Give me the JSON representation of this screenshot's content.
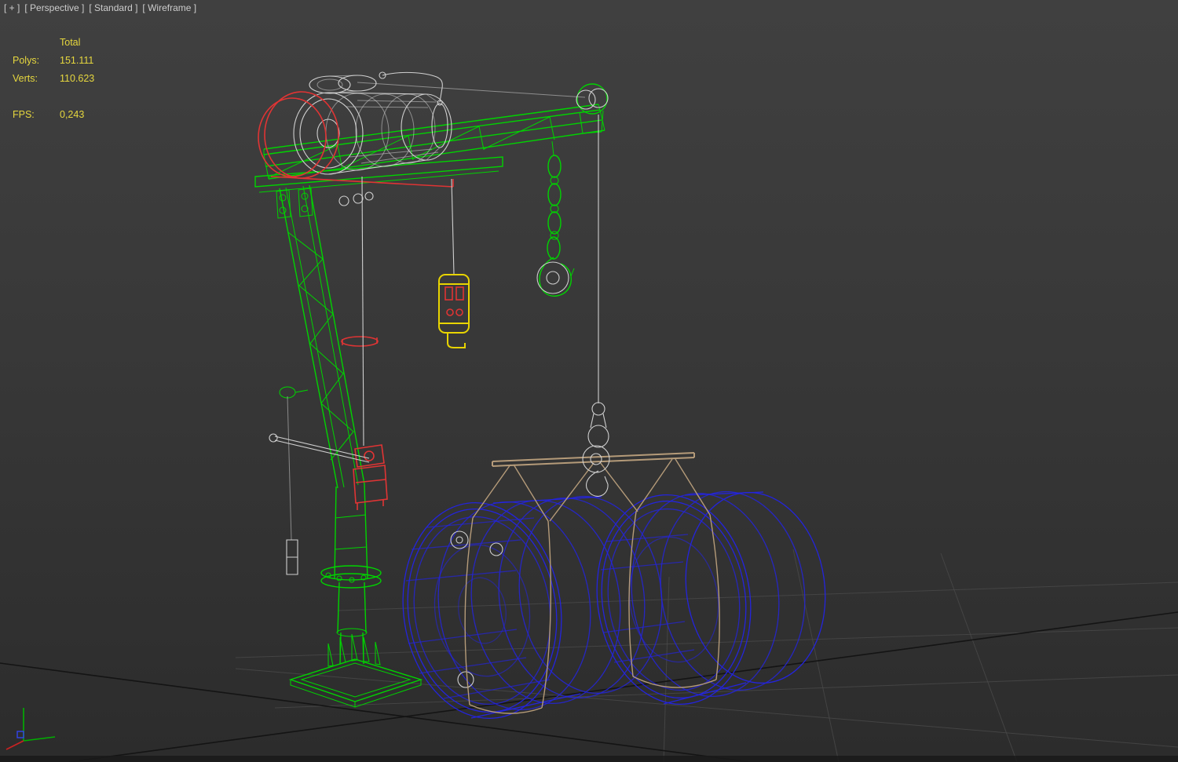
{
  "viewport_label": {
    "plus": "[ + ]",
    "perspective": "[ Perspective ]",
    "standard": "[ Standard ]",
    "wireframe": "[ Wireframe ]"
  },
  "statistics": {
    "total_header": "Total",
    "polys_label": "Polys:",
    "polys_value": "151.111",
    "verts_label": "Verts:",
    "verts_value": "110.623",
    "fps_label": "FPS:",
    "fps_value": "0,243"
  },
  "colors": {
    "bg_top": "#404040",
    "bg_bottom": "#2c2c2c",
    "text_label": "#cccccc",
    "text_stats": "#e6d73e",
    "green": "#00d400",
    "red": "#e03434",
    "blue": "#2424dc",
    "yellow": "#e8d400",
    "wire": "#cfcfcf",
    "tan": "#b59b79",
    "grid_major": "#141414",
    "grid_minor": "#4a4a4a"
  },
  "scene_objects": {
    "crane": "green wireframe jib crane",
    "motor": "white wireframe winch motor",
    "rim": "red selected drum rim",
    "pendant": "yellow control pendant",
    "chain_hook": "green chain and hook",
    "cable_hook": "white cable and hook block",
    "frame": "tan lifting spreader frame",
    "drums": "blue wireframe pipe drums"
  }
}
